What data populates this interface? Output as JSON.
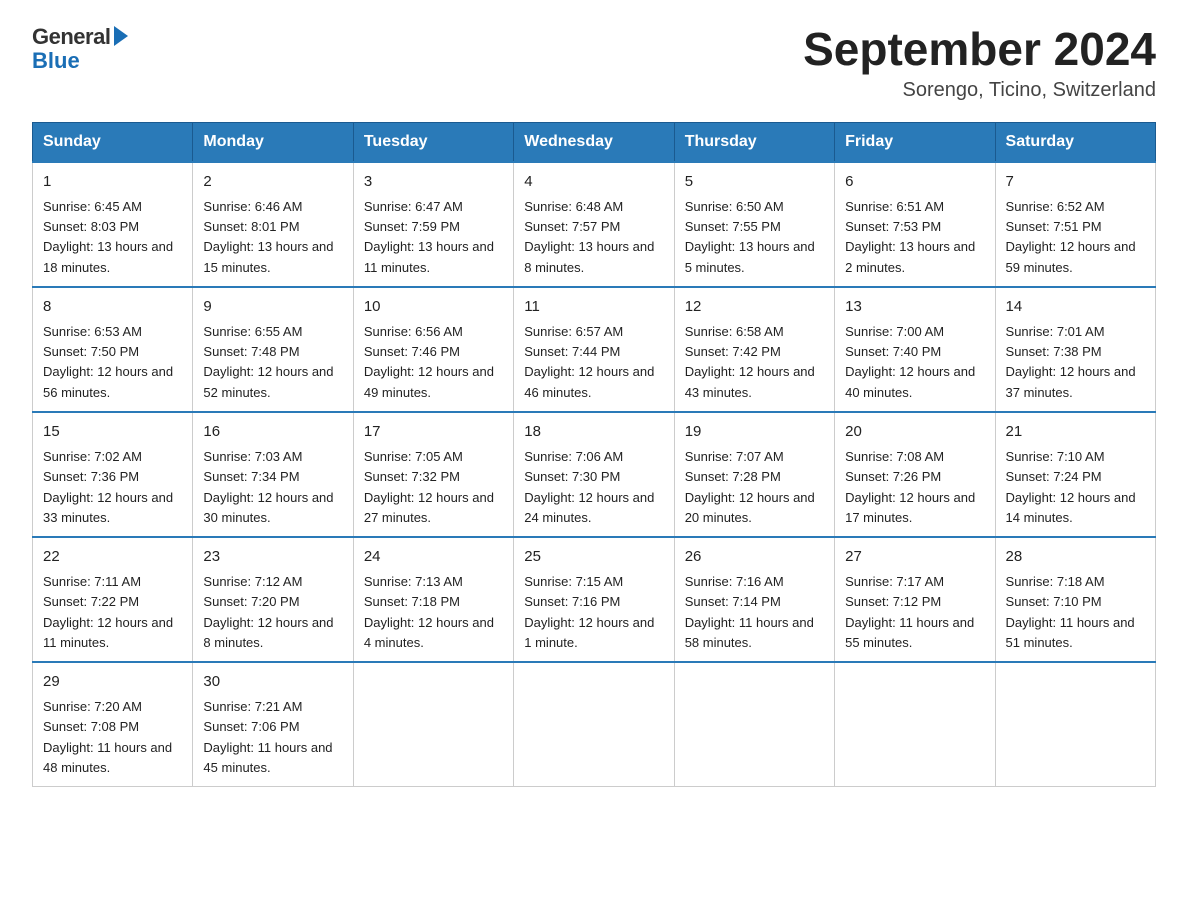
{
  "header": {
    "logo_general": "General",
    "logo_blue": "Blue",
    "month_title": "September 2024",
    "location": "Sorengo, Ticino, Switzerland"
  },
  "days_of_week": [
    "Sunday",
    "Monday",
    "Tuesday",
    "Wednesday",
    "Thursday",
    "Friday",
    "Saturday"
  ],
  "weeks": [
    [
      {
        "day": "1",
        "sunrise": "6:45 AM",
        "sunset": "8:03 PM",
        "daylight": "13 hours and 18 minutes."
      },
      {
        "day": "2",
        "sunrise": "6:46 AM",
        "sunset": "8:01 PM",
        "daylight": "13 hours and 15 minutes."
      },
      {
        "day": "3",
        "sunrise": "6:47 AM",
        "sunset": "7:59 PM",
        "daylight": "13 hours and 11 minutes."
      },
      {
        "day": "4",
        "sunrise": "6:48 AM",
        "sunset": "7:57 PM",
        "daylight": "13 hours and 8 minutes."
      },
      {
        "day": "5",
        "sunrise": "6:50 AM",
        "sunset": "7:55 PM",
        "daylight": "13 hours and 5 minutes."
      },
      {
        "day": "6",
        "sunrise": "6:51 AM",
        "sunset": "7:53 PM",
        "daylight": "13 hours and 2 minutes."
      },
      {
        "day": "7",
        "sunrise": "6:52 AM",
        "sunset": "7:51 PM",
        "daylight": "12 hours and 59 minutes."
      }
    ],
    [
      {
        "day": "8",
        "sunrise": "6:53 AM",
        "sunset": "7:50 PM",
        "daylight": "12 hours and 56 minutes."
      },
      {
        "day": "9",
        "sunrise": "6:55 AM",
        "sunset": "7:48 PM",
        "daylight": "12 hours and 52 minutes."
      },
      {
        "day": "10",
        "sunrise": "6:56 AM",
        "sunset": "7:46 PM",
        "daylight": "12 hours and 49 minutes."
      },
      {
        "day": "11",
        "sunrise": "6:57 AM",
        "sunset": "7:44 PM",
        "daylight": "12 hours and 46 minutes."
      },
      {
        "day": "12",
        "sunrise": "6:58 AM",
        "sunset": "7:42 PM",
        "daylight": "12 hours and 43 minutes."
      },
      {
        "day": "13",
        "sunrise": "7:00 AM",
        "sunset": "7:40 PM",
        "daylight": "12 hours and 40 minutes."
      },
      {
        "day": "14",
        "sunrise": "7:01 AM",
        "sunset": "7:38 PM",
        "daylight": "12 hours and 37 minutes."
      }
    ],
    [
      {
        "day": "15",
        "sunrise": "7:02 AM",
        "sunset": "7:36 PM",
        "daylight": "12 hours and 33 minutes."
      },
      {
        "day": "16",
        "sunrise": "7:03 AM",
        "sunset": "7:34 PM",
        "daylight": "12 hours and 30 minutes."
      },
      {
        "day": "17",
        "sunrise": "7:05 AM",
        "sunset": "7:32 PM",
        "daylight": "12 hours and 27 minutes."
      },
      {
        "day": "18",
        "sunrise": "7:06 AM",
        "sunset": "7:30 PM",
        "daylight": "12 hours and 24 minutes."
      },
      {
        "day": "19",
        "sunrise": "7:07 AM",
        "sunset": "7:28 PM",
        "daylight": "12 hours and 20 minutes."
      },
      {
        "day": "20",
        "sunrise": "7:08 AM",
        "sunset": "7:26 PM",
        "daylight": "12 hours and 17 minutes."
      },
      {
        "day": "21",
        "sunrise": "7:10 AM",
        "sunset": "7:24 PM",
        "daylight": "12 hours and 14 minutes."
      }
    ],
    [
      {
        "day": "22",
        "sunrise": "7:11 AM",
        "sunset": "7:22 PM",
        "daylight": "12 hours and 11 minutes."
      },
      {
        "day": "23",
        "sunrise": "7:12 AM",
        "sunset": "7:20 PM",
        "daylight": "12 hours and 8 minutes."
      },
      {
        "day": "24",
        "sunrise": "7:13 AM",
        "sunset": "7:18 PM",
        "daylight": "12 hours and 4 minutes."
      },
      {
        "day": "25",
        "sunrise": "7:15 AM",
        "sunset": "7:16 PM",
        "daylight": "12 hours and 1 minute."
      },
      {
        "day": "26",
        "sunrise": "7:16 AM",
        "sunset": "7:14 PM",
        "daylight": "11 hours and 58 minutes."
      },
      {
        "day": "27",
        "sunrise": "7:17 AM",
        "sunset": "7:12 PM",
        "daylight": "11 hours and 55 minutes."
      },
      {
        "day": "28",
        "sunrise": "7:18 AM",
        "sunset": "7:10 PM",
        "daylight": "11 hours and 51 minutes."
      }
    ],
    [
      {
        "day": "29",
        "sunrise": "7:20 AM",
        "sunset": "7:08 PM",
        "daylight": "11 hours and 48 minutes."
      },
      {
        "day": "30",
        "sunrise": "7:21 AM",
        "sunset": "7:06 PM",
        "daylight": "11 hours and 45 minutes."
      },
      null,
      null,
      null,
      null,
      null
    ]
  ]
}
